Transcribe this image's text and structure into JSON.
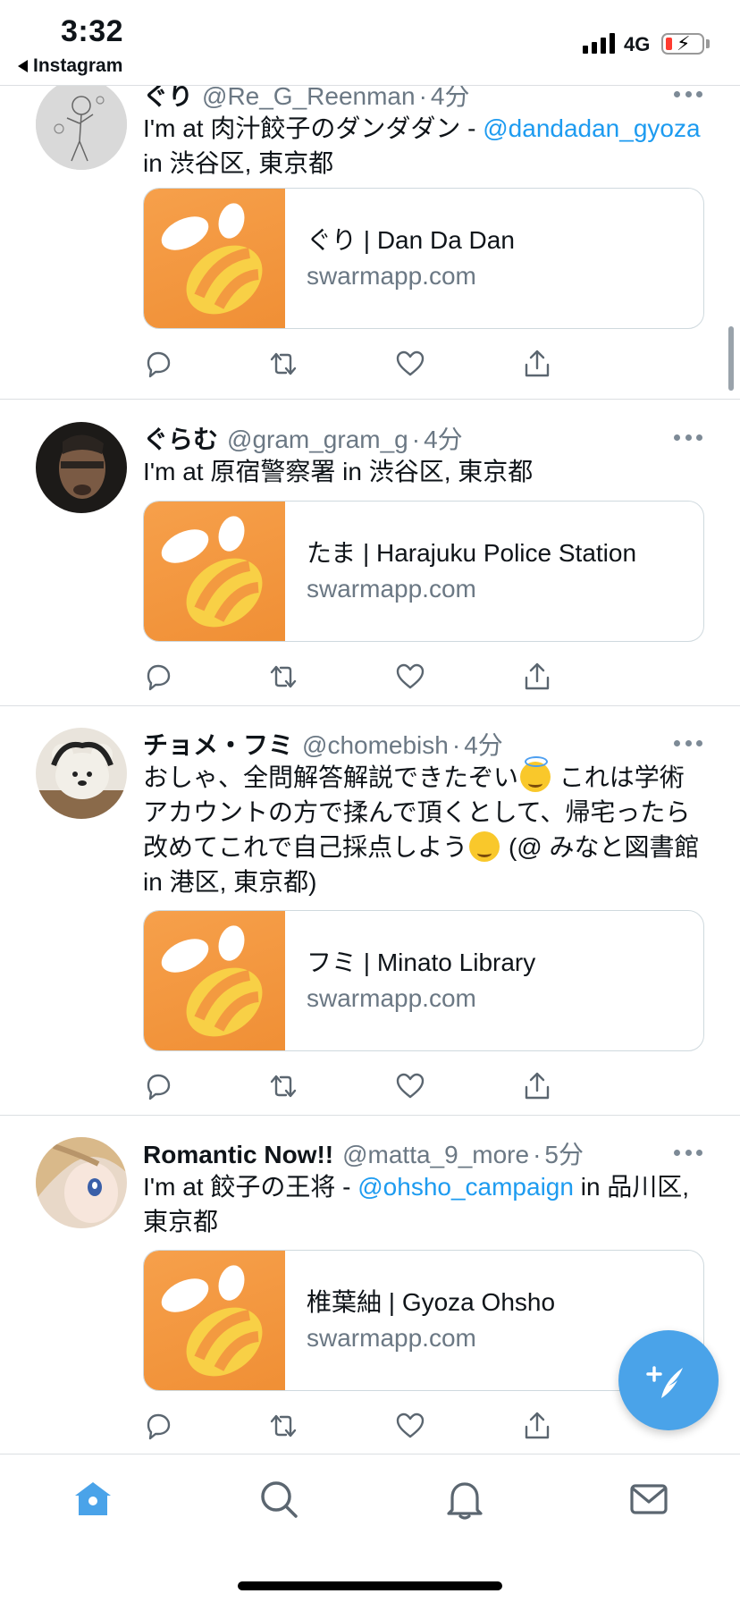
{
  "status_bar": {
    "time": "3:32",
    "back_app": "Instagram",
    "network": "4G"
  },
  "tweets": [
    {
      "name": "ぐり",
      "handle": "@Re_G_Reenman",
      "separator": "·",
      "age": "4分",
      "text_parts": [
        "I'm at 肉汁餃子のダンダダン - ",
        "@dandadan_gyoza",
        " in 渋谷区, 東京都"
      ],
      "card_title": "ぐり | Dan Da Dan",
      "card_domain": "swarmapp.com"
    },
    {
      "name": "ぐらむ",
      "handle": "@gram_gram_g",
      "separator": "·",
      "age": "4分",
      "text_parts": [
        "I'm at 原宿警察署 in 渋谷区, 東京都"
      ],
      "card_title": "たま | Harajuku Police Station",
      "card_domain": "swarmapp.com"
    },
    {
      "name": "チョメ・フミ",
      "handle": "@chomebish",
      "separator": "·",
      "age": "4分",
      "text_parts": [
        "おしゃ、全問解答解説できたぞい",
        " これは学術アカウントの方で揉んで頂くとして、帰宅ったら改めてこれで自己採点しよう",
        " (@ みなと図書館 in 港区, 東京都)"
      ],
      "card_title": "フミ | Minato Library",
      "card_domain": "swarmapp.com"
    },
    {
      "name": "Romantic Now!!",
      "handle": "@matta_9_more",
      "separator": "·",
      "age": "5分",
      "text_parts": [
        "I'm at 餃子の王将 - ",
        "@ohsho_campaign",
        " in 品川区, 東京都"
      ],
      "card_title": "椎葉紬 | Gyoza Ohsho",
      "card_domain": "swarmapp.com"
    }
  ],
  "colors": {
    "link": "#1d9bf0",
    "swarm_orange": "#f39a40",
    "tab_active": "#4aa3e9",
    "fab": "#4aa3e9"
  },
  "icons": {
    "actions": [
      "reply-icon",
      "retweet-icon",
      "like-icon",
      "share-icon"
    ],
    "tabs": [
      "home-icon",
      "search-icon",
      "notifications-icon",
      "messages-icon"
    ],
    "fab": "compose-tweet-icon"
  }
}
